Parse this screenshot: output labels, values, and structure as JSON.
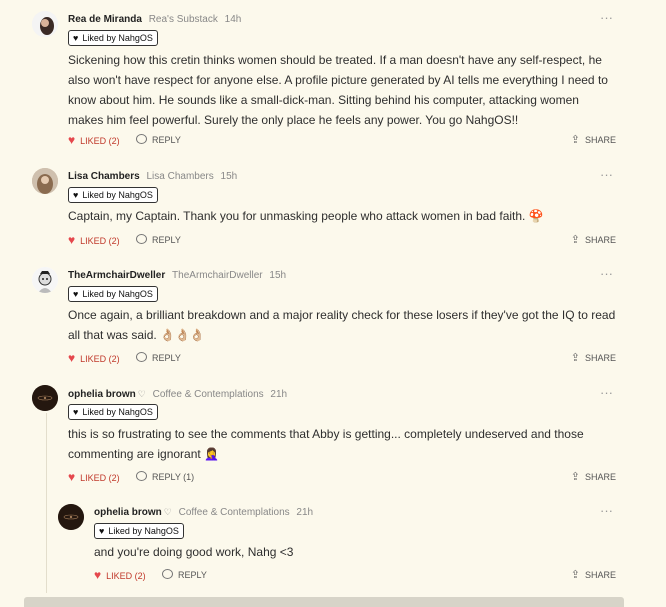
{
  "comments": [
    {
      "author": "Rea de Miranda",
      "publication": "Rea's Substack",
      "time": "14h",
      "liked_by": "Liked by NahgOS",
      "lines": [
        "Sickening how this cretin thinks women should be treated. If a man doesn't have any self-respect, he",
        "also won't have respect for anyone else. A profile picture generated by AI tells me everything I need to",
        "know about him. He sounds like a small-dick-man. Sitting behind his computer, attacking women",
        "makes him feel powerful. Surely the only place he feels any power. You go NahgOS!!"
      ],
      "liked": "LIKED (2)",
      "reply": "REPLY",
      "share": "SHARE"
    },
    {
      "author": "Lisa Chambers",
      "publication": "Lisa Chambers",
      "time": "15h",
      "liked_by": "Liked by NahgOS",
      "lines": [
        "Captain, my Captain. Thank you for unmasking people who attack women in bad faith. 🍄"
      ],
      "liked": "LIKED (2)",
      "reply": "REPLY",
      "share": "SHARE"
    },
    {
      "author": "TheArmchairDweller",
      "publication": "TheArmchairDweller",
      "time": "15h",
      "liked_by": "Liked by NahgOS",
      "lines": [
        "Once again, a brilliant breakdown and a major reality check for these losers if they've got the IQ to read",
        "all that was said. 👌🏼👌🏼👌🏼"
      ],
      "liked": "LIKED (2)",
      "reply": "REPLY",
      "share": "SHARE"
    },
    {
      "author": "ophelia brown",
      "author_icon": "♡",
      "publication": "Coffee & Contemplations",
      "time": "21h",
      "liked_by": "Liked by NahgOS",
      "lines": [
        "this is so frustrating to see the comments that Abby is getting... completely undeserved and those",
        "commenting are ignorant 🤦‍♀️"
      ],
      "liked": "LIKED (2)",
      "reply": "REPLY (1)",
      "share": "SHARE"
    },
    {
      "author": "ophelia brown",
      "author_icon": "♡",
      "publication": "Coffee & Contemplations",
      "time": "21h",
      "liked_by": "Liked by NahgOS",
      "lines": [
        "and you're doing good work, Nahg <3"
      ],
      "liked": "LIKED (2)",
      "reply": "REPLY",
      "share": "SHARE"
    }
  ],
  "icons": {
    "more": "more-options-icon",
    "heart": "heart-icon",
    "reply": "reply-bubble-icon",
    "share": "share-icon"
  },
  "colors": {
    "background": "#fcf9ec",
    "liked": "#c0392b",
    "heart": "#e5484d"
  }
}
